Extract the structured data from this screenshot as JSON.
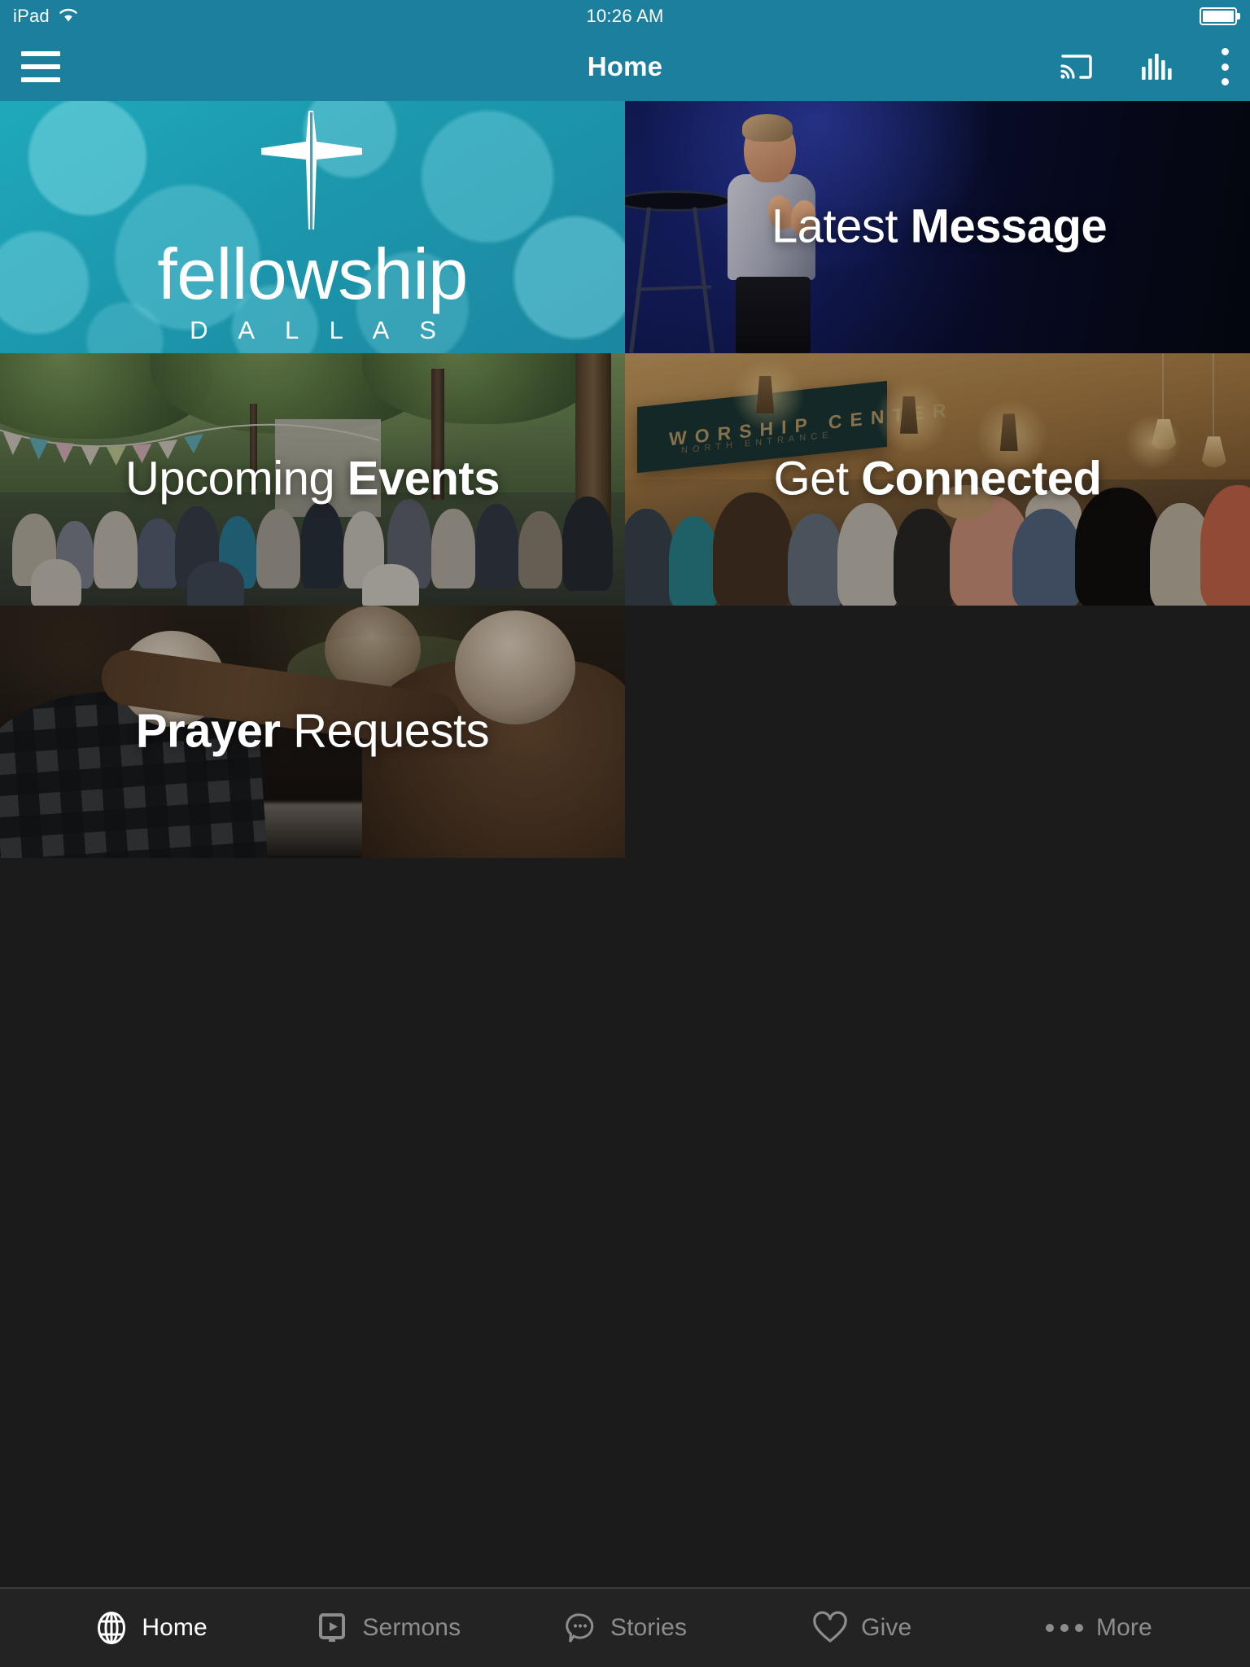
{
  "status_bar": {
    "carrier": "iPad",
    "wifi_icon": "wifi-icon",
    "time": "10:26 AM",
    "battery_icon": "battery-full-icon",
    "battery_level_pct": 100
  },
  "nav_bar": {
    "menu_icon": "hamburger-menu-icon",
    "title": "Home",
    "actions": [
      {
        "icon": "chromecast-icon",
        "name": "cast-button"
      },
      {
        "icon": "audio-bars-icon",
        "name": "now-playing-button"
      },
      {
        "icon": "kebab-menu-icon",
        "name": "overflow-menu-button"
      }
    ]
  },
  "accent_color": "#1c7f9e",
  "background_color": "#1b1b1b",
  "tab_bar_color": "#232323",
  "tiles": [
    {
      "id": "logo",
      "type": "logo",
      "brand_word": "fellowship",
      "brand_sub": "D A L L A S",
      "icon": "cross-icon",
      "label_light": "",
      "label_bold": ""
    },
    {
      "id": "latest-message",
      "type": "link",
      "label_light": "Latest",
      "label_bold": "Message"
    },
    {
      "id": "upcoming-events",
      "type": "link",
      "label_light": "Upcoming",
      "label_bold": "Events"
    },
    {
      "id": "get-connected",
      "type": "link",
      "label_light": "Get",
      "label_bold": "Connected"
    },
    {
      "id": "prayer-requests",
      "type": "link",
      "label_light": "Requests",
      "label_bold": "Prayer"
    }
  ],
  "tile_overlay_text": {
    "get_connected_sign": "WORSHIP CENTER",
    "get_connected_sign_sub": "NORTH ENTRANCE"
  },
  "tab_bar": {
    "items": [
      {
        "label": "Home",
        "icon": "globe-icon",
        "active": true
      },
      {
        "label": "Sermons",
        "icon": "video-screen-icon",
        "active": false
      },
      {
        "label": "Stories",
        "icon": "speech-bubble-icon",
        "active": false
      },
      {
        "label": "Give",
        "icon": "heart-icon",
        "active": false
      },
      {
        "label": "More",
        "icon": "ellipsis-icon",
        "active": false
      }
    ]
  }
}
